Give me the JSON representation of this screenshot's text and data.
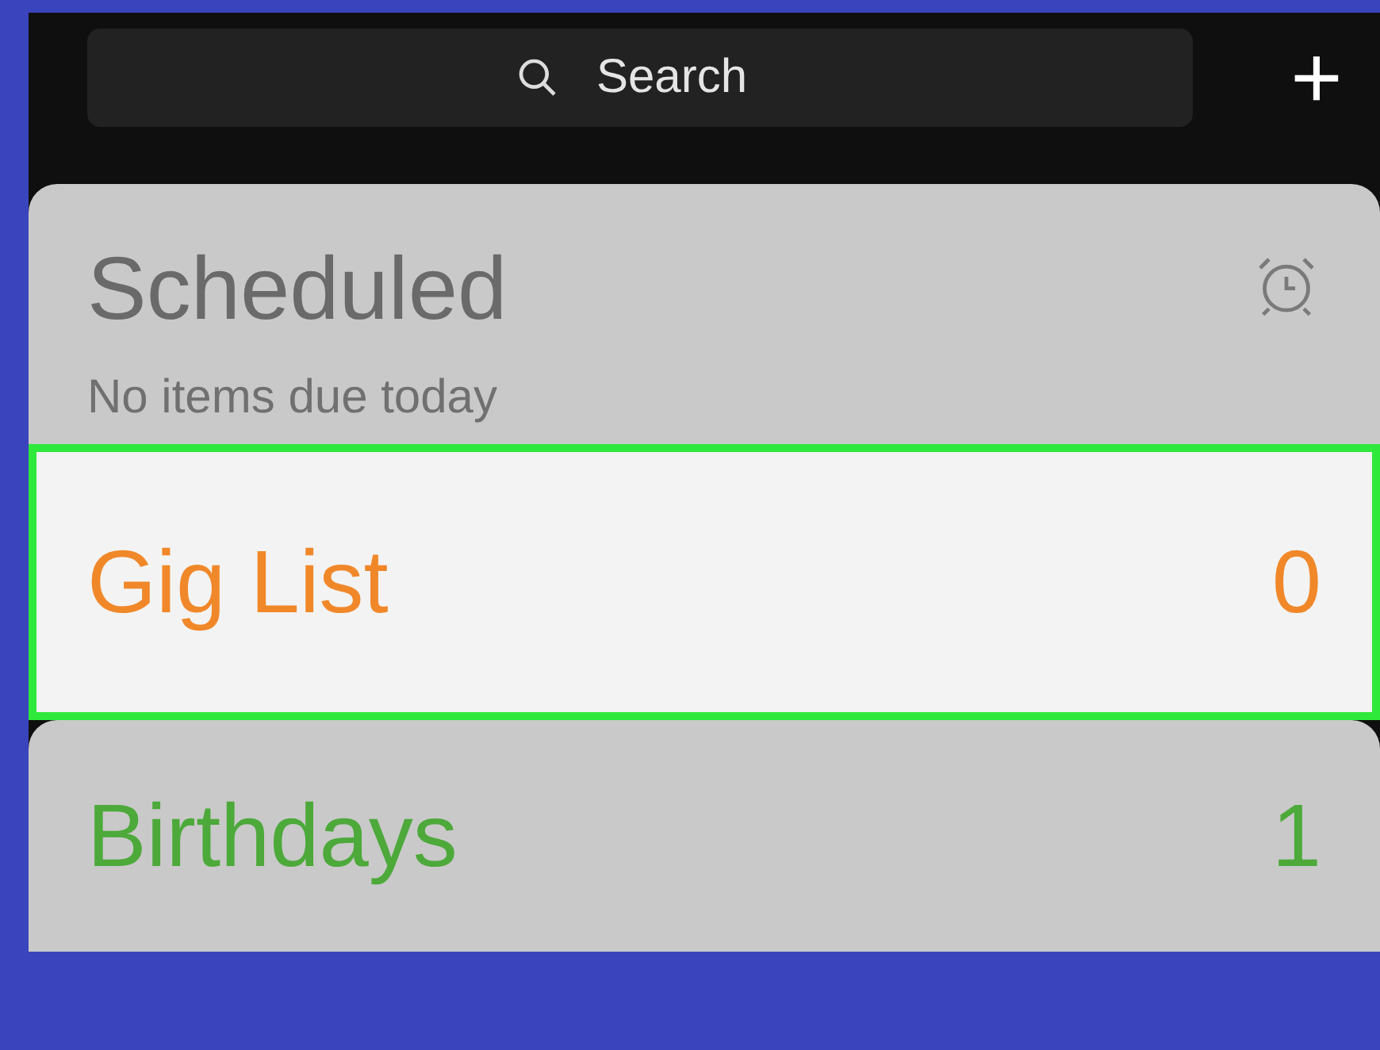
{
  "search": {
    "placeholder": "Search"
  },
  "add_button": {
    "label": "+"
  },
  "scheduled": {
    "title": "Scheduled",
    "subtitle": "No items due today"
  },
  "lists": [
    {
      "name": "Gig List",
      "count": "0",
      "color": "#f0882a",
      "selected": true
    },
    {
      "name": "Birthdays",
      "count": "1",
      "color": "#4ca93a",
      "selected": false
    }
  ]
}
